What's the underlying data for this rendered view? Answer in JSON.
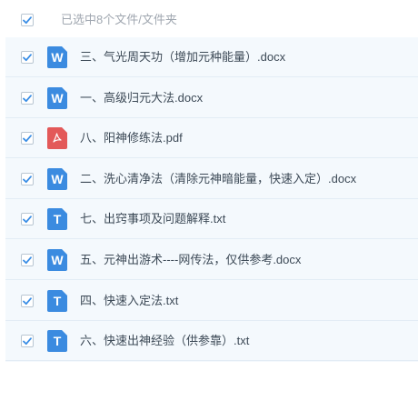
{
  "header": {
    "summary": "已选中8个文件/文件夹"
  },
  "colors": {
    "check": "#3a8ee6",
    "word": "#3b8be0",
    "pdf": "#e35959",
    "txt": "#3b8be0"
  },
  "files": [
    {
      "name": "三、气光周天功（增加元种能量）.docx",
      "type": "word",
      "icon_letter": "W"
    },
    {
      "name": "一、高级归元大法.docx",
      "type": "word",
      "icon_letter": "W"
    },
    {
      "name": "八、阳神修练法.pdf",
      "type": "pdf",
      "icon_letter": ""
    },
    {
      "name": "二、洗心清净法（清除元神暗能量，快速入定）.docx",
      "type": "word",
      "icon_letter": "W"
    },
    {
      "name": "七、出窍事项及问题解释.txt",
      "type": "txt",
      "icon_letter": "T"
    },
    {
      "name": "五、元神出游术----网传法，仅供参考.docx",
      "type": "word",
      "icon_letter": "W"
    },
    {
      "name": "四、快速入定法.txt",
      "type": "txt",
      "icon_letter": "T"
    },
    {
      "name": "六、快速出神经验（供参靠）.txt",
      "type": "txt",
      "icon_letter": "T"
    }
  ]
}
